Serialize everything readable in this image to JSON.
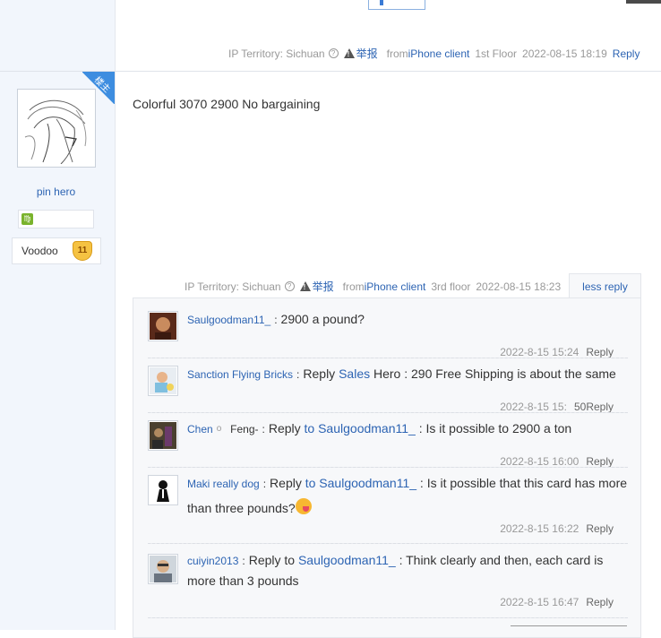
{
  "top_tail": {
    "ip_label": "IP Territory: Sichuan",
    "report": "举报",
    "from": "from",
    "from_client": "iPhone client",
    "floor": "1st Floor",
    "time": "2022-08-15 18:19",
    "reply": "Reply"
  },
  "author": {
    "badge": "楼主",
    "name": "pin hero",
    "rank_icon": "♍",
    "level_label": "Voodoo",
    "level_num": "11"
  },
  "post": {
    "content": "Colorful 3070 2900 No bargaining"
  },
  "post_tail": {
    "ip_label": "IP Territory: Sichuan",
    "report": "举报",
    "from": "from",
    "from_client": "iPhone client",
    "floor": "3rd floor",
    "time": "2022-08-15 18:23",
    "less_reply": "less reply"
  },
  "replies": [
    {
      "user": "Saulgoodman11_",
      "text": "2900 a pound?",
      "time": "2022-8-15 15:24",
      "reply": "Reply"
    },
    {
      "user": "Sanction Flying Bricks",
      "prefix": "Reply",
      "target": "Sales",
      "text": "Hero : 290 Free Shipping is about the same",
      "time": "2022-8-15 15:",
      "time_extra": "50",
      "reply": "Reply"
    },
    {
      "user": "Chen",
      "user_mark": "o",
      "user2": "Feng-",
      "prefix": "Reply",
      "target": "to Saulgoodman11_",
      "text": ": Is it possible to 2900 a ton",
      "time": "2022-8-15 16:00",
      "reply": "Reply"
    },
    {
      "user": "Maki really dog",
      "prefix": "Reply",
      "target": "to Saulgoodman11_",
      "text": ": Is it possible that this card has more than three pounds?",
      "time": "2022-8-15 16:22",
      "reply": "Reply"
    },
    {
      "user": "cuiyin2013",
      "prefix": "Reply to",
      "target": "Saulgoodman11_",
      "text": ": Think clearly and then, each card is more than 3 pounds",
      "time": "2022-8-15 16:47",
      "reply": "Reply"
    }
  ],
  "icons": {
    "help": "?",
    "report": "warning-icon"
  },
  "colors": {
    "link": "#2d64b3",
    "sidebar_bg": "#f2f6fc",
    "badge_bg": "#3d8de0"
  }
}
